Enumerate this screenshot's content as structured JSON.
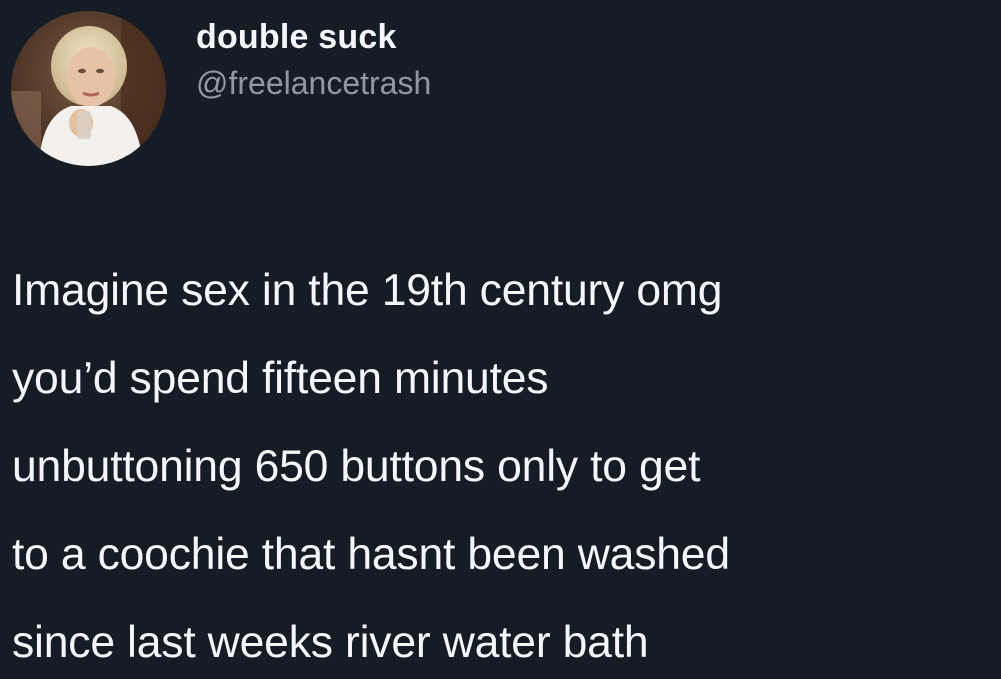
{
  "tweet": {
    "author": {
      "display_name": "double suck",
      "handle": "@freelancetrash",
      "avatar_icon": "profile-photo-avatar"
    },
    "text_lines": [
      "Imagine sex in the 19th century omg",
      "you’d spend fifteen minutes",
      "unbuttoning 650 buttons only to get",
      "to a coochie that hasnt been washed",
      "since last weeks river water bath"
    ]
  },
  "colors": {
    "background": "#161c26",
    "text": "#f4f6f9",
    "handle": "#8f99a6"
  }
}
